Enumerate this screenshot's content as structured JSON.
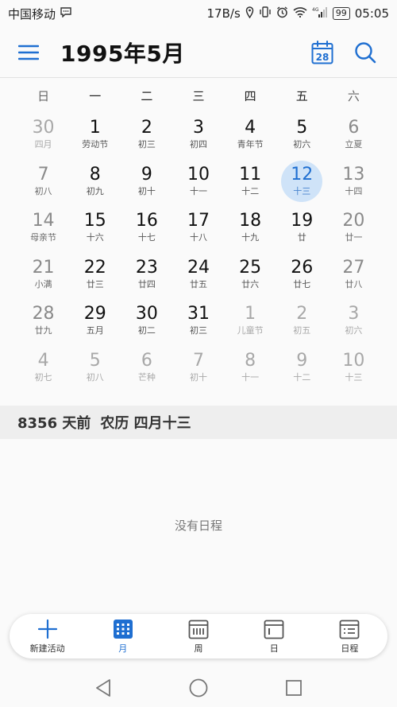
{
  "status_bar": {
    "carrier": "中国移动",
    "speed": "17B/s",
    "battery": "99",
    "time": "05:05",
    "network": "4G"
  },
  "header": {
    "title": "1995年5月",
    "calendar_today_day": "28"
  },
  "weekdays": [
    "日",
    "一",
    "二",
    "三",
    "四",
    "五",
    "六"
  ],
  "days": [
    {
      "n": "30",
      "l": "四月",
      "muted": true
    },
    {
      "n": "1",
      "l": "劳动节"
    },
    {
      "n": "2",
      "l": "初三"
    },
    {
      "n": "3",
      "l": "初四"
    },
    {
      "n": "4",
      "l": "青年节"
    },
    {
      "n": "5",
      "l": "初六"
    },
    {
      "n": "6",
      "l": "立夏"
    },
    {
      "n": "7",
      "l": "初八"
    },
    {
      "n": "8",
      "l": "初九"
    },
    {
      "n": "9",
      "l": "初十"
    },
    {
      "n": "10",
      "l": "十一"
    },
    {
      "n": "11",
      "l": "十二"
    },
    {
      "n": "12",
      "l": "十三",
      "selected": true
    },
    {
      "n": "13",
      "l": "十四"
    },
    {
      "n": "14",
      "l": "母亲节"
    },
    {
      "n": "15",
      "l": "十六"
    },
    {
      "n": "16",
      "l": "十七"
    },
    {
      "n": "17",
      "l": "十八"
    },
    {
      "n": "18",
      "l": "十九"
    },
    {
      "n": "19",
      "l": "廿"
    },
    {
      "n": "20",
      "l": "廿一"
    },
    {
      "n": "21",
      "l": "小满"
    },
    {
      "n": "22",
      "l": "廿三"
    },
    {
      "n": "23",
      "l": "廿四"
    },
    {
      "n": "24",
      "l": "廿五"
    },
    {
      "n": "25",
      "l": "廿六"
    },
    {
      "n": "26",
      "l": "廿七"
    },
    {
      "n": "27",
      "l": "廿八"
    },
    {
      "n": "28",
      "l": "廿九"
    },
    {
      "n": "29",
      "l": "五月"
    },
    {
      "n": "30",
      "l": "初二"
    },
    {
      "n": "31",
      "l": "初三"
    },
    {
      "n": "1",
      "l": "儿童节",
      "muted": true
    },
    {
      "n": "2",
      "l": "初五",
      "muted": true
    },
    {
      "n": "3",
      "l": "初六",
      "muted": true
    },
    {
      "n": "4",
      "l": "初七",
      "muted": true
    },
    {
      "n": "5",
      "l": "初八",
      "muted": true
    },
    {
      "n": "6",
      "l": "芒种",
      "muted": true
    },
    {
      "n": "7",
      "l": "初十",
      "muted": true
    },
    {
      "n": "8",
      "l": "十一",
      "muted": true
    },
    {
      "n": "9",
      "l": "十二",
      "muted": true
    },
    {
      "n": "10",
      "l": "十三",
      "muted": true
    }
  ],
  "info": {
    "days_ago": "8356 天前",
    "lunar": "农历 四月十三"
  },
  "empty_text": "没有日程",
  "toolbar": [
    {
      "label": "新建活动",
      "icon": "plus-icon"
    },
    {
      "label": "月",
      "icon": "month-view-icon",
      "active": true
    },
    {
      "label": "周",
      "icon": "week-view-icon"
    },
    {
      "label": "日",
      "icon": "day-view-icon"
    },
    {
      "label": "日程",
      "icon": "agenda-view-icon"
    }
  ],
  "colors": {
    "accent": "#1f6fd1",
    "selected_bg": "#cfe3f8",
    "muted": "#a8a8a8"
  }
}
